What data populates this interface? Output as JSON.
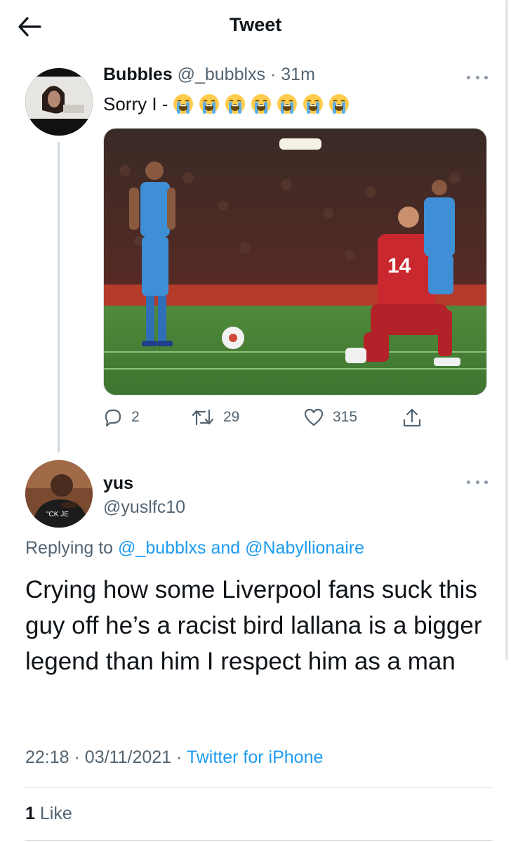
{
  "header": {
    "title": "Tweet",
    "back_icon": "arrow-left-icon"
  },
  "tweet1": {
    "name": "Bubbles",
    "handle": "@_bubblxs",
    "separator": "·",
    "time": "31m",
    "text": "Sorry I -",
    "emoji_count": 7,
    "emoji": "loudly-crying-face",
    "media_description": "football-photo",
    "actions": {
      "replies": "2",
      "retweets": "29",
      "likes": "315"
    }
  },
  "tweet2": {
    "name": "yus",
    "handle": "@yuslfc10",
    "replying_prefix": "Replying to",
    "replying_user1": "@_bubblxs",
    "replying_and": "and",
    "replying_user2": "@Nabyllionaire",
    "text": "Crying how some Liverpool fans suck this guy off he’s a racist bird lallana is a bigger legend than him I respect him as a man",
    "time": "22:18",
    "date": "03/11/2021",
    "source": "Twitter for iPhone",
    "sep": "·",
    "likes_count": "1",
    "likes_label": "Like"
  },
  "colors": {
    "link": "#1d9bf0",
    "muted": "#536471",
    "text": "#0f1419"
  }
}
